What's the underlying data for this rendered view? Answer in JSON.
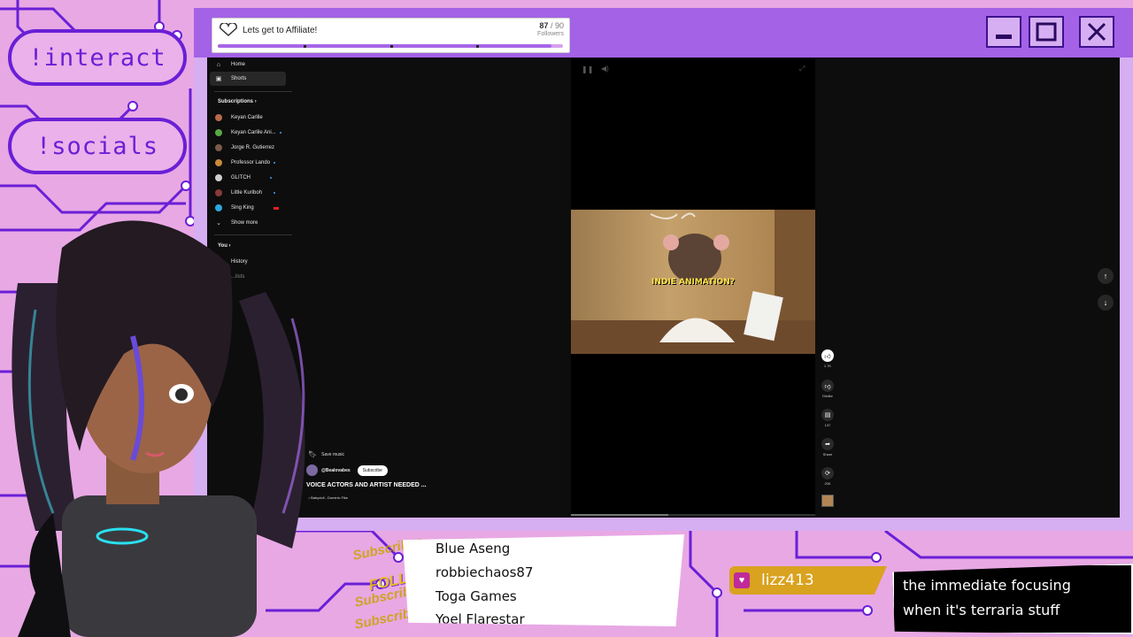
{
  "overlay": {
    "commands": [
      "!interact",
      "!socials"
    ],
    "window_buttons": {
      "minimize": "minimize-icon",
      "maximize": "maximize-icon",
      "close": "close-icon"
    },
    "colors": {
      "accent": "#a462e6",
      "pink": "#e8a8e4",
      "border": "#6a1fd6",
      "gold": "#d9a21f"
    }
  },
  "goal": {
    "title": "Lets get to Affiliate!",
    "current": "87",
    "sep": "/",
    "target": "90",
    "unit": "Followers",
    "progress": 0.967
  },
  "sidebar": {
    "top": [
      {
        "label": "Home",
        "icon": "home-icon"
      },
      {
        "label": "Shorts",
        "icon": "shorts-icon"
      }
    ],
    "subscriptions_header": "Subscriptions",
    "subscriptions": [
      {
        "label": "Keyan Carlile",
        "color": "#b86a4a",
        "dot": false
      },
      {
        "label": "Keyan Carlile Ani...",
        "color": "#5aa845",
        "dot": true
      },
      {
        "label": "Jorge R. Gutierrez",
        "color": "#7a5a48",
        "dot": false
      },
      {
        "label": "Professor Lando",
        "color": "#c98a3c",
        "dot": true
      },
      {
        "label": "GLITCH",
        "color": "#cfcfcf",
        "dot": true
      },
      {
        "label": "Little Kuriboh",
        "color": "#8a3a3a",
        "dot": true
      },
      {
        "label": "Sing King",
        "color": "#2aa8e0",
        "dot": true
      }
    ],
    "show_more": "Show more",
    "you_header": "You",
    "you": [
      {
        "label": "History",
        "icon": "history-icon"
      },
      {
        "label": "...lists",
        "icon": "playlist-icon"
      }
    ]
  },
  "short": {
    "caption": "INDIE ANIMATION?",
    "save_music": "Save music",
    "channel": "@Bealovabes",
    "subscribe": "Subscribe",
    "title": "VOICE ACTORS AND ARTIST NEEDED ...",
    "music": "Babydoll - Dominic Fike"
  },
  "actions": [
    {
      "name": "like",
      "icon": "thumbs-up-icon",
      "label": "1.7K"
    },
    {
      "name": "dislike",
      "icon": "thumbs-down-icon",
      "label": "Dislike"
    },
    {
      "name": "comments",
      "icon": "comment-icon",
      "label": "137"
    },
    {
      "name": "share",
      "icon": "share-icon",
      "label": "Share"
    },
    {
      "name": "remix",
      "icon": "remix-icon",
      "label": "20K"
    }
  ],
  "nav": {
    "up": "arrow-up-icon",
    "down": "arrow-down-icon"
  },
  "recent_events": {
    "names": [
      "Blue Aseng",
      "robbiechaos87",
      "Toga Games",
      "Yoel Flarestar"
    ],
    "tags": [
      "Subscriber",
      "FOLLOW",
      "Subscriber",
      "Subscriber"
    ]
  },
  "chat": {
    "username": "lizz413",
    "message_line1": "the immediate focusing",
    "message_line2": "when it's terraria stuff"
  }
}
